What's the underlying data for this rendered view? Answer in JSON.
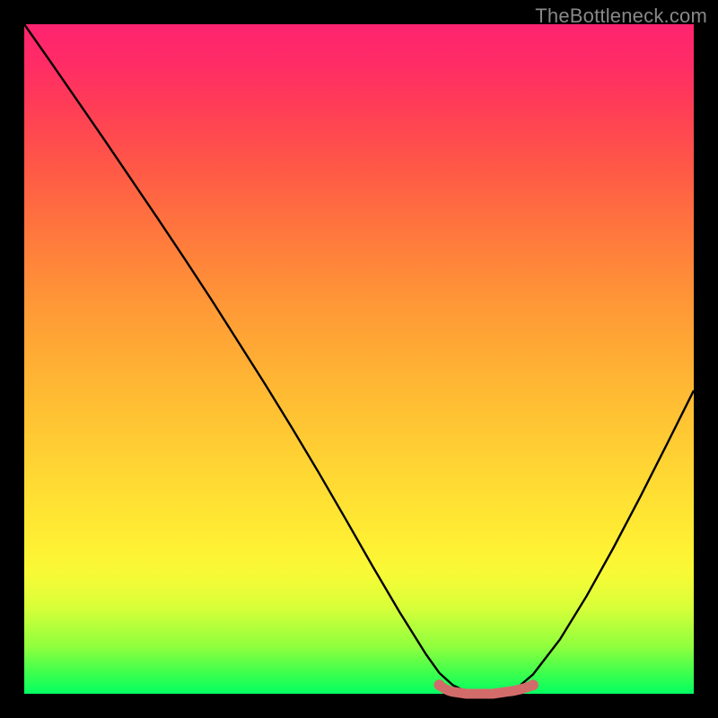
{
  "watermark": "TheBottleneck.com",
  "colors": {
    "frame": "#000000",
    "curve": "#000000",
    "marker_fill": "#d16c6b",
    "gradient_top": "#ff2370",
    "gradient_bottom": "#03ff62"
  },
  "chart_data": {
    "type": "line",
    "title": "",
    "xlabel": "",
    "ylabel": "",
    "xlim": [
      0,
      100
    ],
    "ylim": [
      0,
      100
    ],
    "grid": false,
    "series": [
      {
        "name": "bottleneck-curve",
        "x": [
          0,
          4,
          8,
          12,
          16,
          20,
          24,
          28,
          32,
          36,
          40,
          44,
          48,
          52,
          56,
          60,
          62,
          64,
          66,
          68,
          70,
          72,
          74,
          76,
          80,
          84,
          88,
          92,
          96,
          100
        ],
        "values": [
          100,
          94.3,
          88.5,
          82.7,
          76.8,
          70.9,
          64.9,
          58.8,
          52.5,
          46.2,
          39.7,
          33.0,
          26.1,
          19.1,
          12.3,
          5.9,
          3.1,
          1.3,
          0.3,
          0.0,
          0.0,
          0.3,
          1.2,
          2.9,
          8.1,
          14.6,
          21.8,
          29.4,
          37.3,
          45.3
        ]
      }
    ],
    "markers": {
      "name": "highlight-segment",
      "x_start": 62,
      "x_end": 76,
      "y": 1.3
    },
    "annotations": []
  }
}
